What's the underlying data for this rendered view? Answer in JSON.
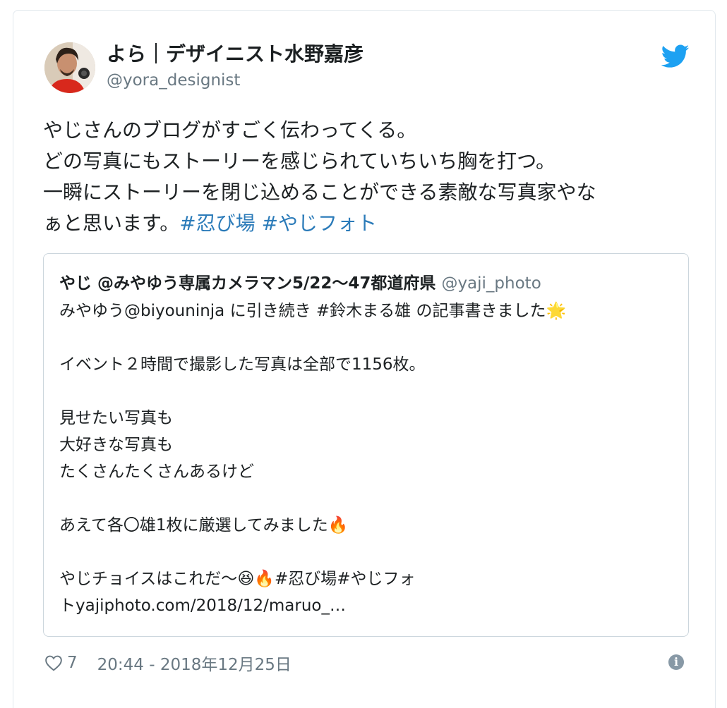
{
  "author": {
    "name": "よら｜デザイニスト水野嘉彦",
    "handle": "@yora_designist"
  },
  "tweet": {
    "lines": [
      "やじさんのブログがすごく伝わってくる。",
      "どの写真にもストーリーを感じられていちいち胸を打つ。",
      "一瞬にストーリーを閉じ込めることができる素敵な写真家やな",
      "ぁと思います。"
    ],
    "hashtags": [
      "#忍び場",
      "#やじフォト"
    ]
  },
  "quote": {
    "name": "やじ @みやゆう専属カメラマン5/22〜47都道府県",
    "handle": "@yaji_photo",
    "lines": [
      "みやゆう@biyouninja に引き続き #鈴木まる雄 の記事書きました",
      "",
      "イベント２時間で撮影した写真は全部で1156枚。",
      "",
      "見せたい写真も",
      "大好きな写真も",
      "たくさんたくさんあるけど",
      "",
      "あえて各〇雄1枚に厳選してみました",
      "",
      "やじチョイスはこれだ〜",
      "#忍び場#やじフォ",
      "トyajiphoto.com/2018/12/maruo_…"
    ],
    "emojis": {
      "line1": "🌟",
      "line9": "🔥",
      "line11a": "😆",
      "line11b": "🔥"
    }
  },
  "footer": {
    "likes": "7",
    "timestamp": "20:44 - 2018年12月25日"
  },
  "icons": [
    "twitter-bird-icon",
    "heart-icon",
    "info-icon"
  ],
  "colors": {
    "accent": "#1da1f2",
    "hashtag": "#2b7bb9",
    "secondary_text": "#697882",
    "border": "#e1e8ed"
  }
}
